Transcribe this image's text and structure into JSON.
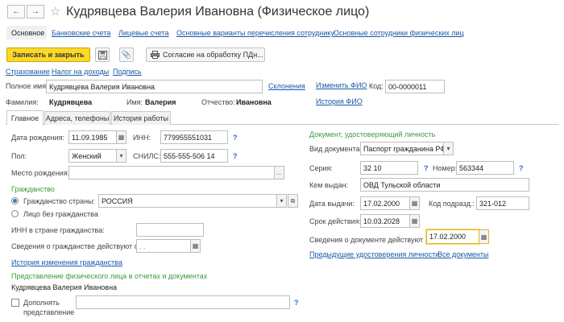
{
  "window": {
    "title": "Кудрявцева Валерия Ивановна (Физическое лицо)",
    "back_icon": "arrow-left-icon",
    "forward_icon": "arrow-right-icon",
    "star_icon": "star-icon"
  },
  "top_tabs": [
    "Основное",
    "Банковские счета",
    "Лицевые счета",
    "Основные варианты перечисления сотруднику",
    "Основные сотрудники физических лиц"
  ],
  "toolbar": {
    "save_close": "Записать и закрыть",
    "consent": "Согласие на обработку ПДн..."
  },
  "links_row": [
    "Страхование",
    "Налог на доходы",
    "Подпись"
  ],
  "person": {
    "full_name_label": "Полное имя:",
    "full_name": "Кудрявцева Валерия Ивановна",
    "declension": "Склонения",
    "change_fio": "Изменить ФИО",
    "code_label": "Код:",
    "code": "00-0000011",
    "history_fio": "История ФИО",
    "surname_label": "Фамилия:",
    "surname": "Кудрявцева",
    "name_label": "Имя:",
    "name": "Валерия",
    "patronymic_label": "Отчество:",
    "patronymic": "Ивановна"
  },
  "inner_tabs": [
    "Главное",
    "Адреса, телефоны",
    "История работы"
  ],
  "main": {
    "birth_label": "Дата рождения:",
    "birth": "11.09.1985",
    "inn_label": "ИНН:",
    "inn": "779955551031",
    "gender_label": "Пол:",
    "gender": "Женский",
    "snils_label": "СНИЛС:",
    "snils": "555-555-506 14",
    "birthplace_label": "Место рождения:",
    "birthplace": "",
    "citizenship_header": "Гражданство",
    "citizen_label": "Гражданство страны:",
    "country": "РОССИЯ",
    "stateless_label": "Лицо без гражданства",
    "foreign_inn_label": "ИНН в стране гражданства:",
    "citizen_valid_label": "Сведения о гражданстве действуют с:",
    "citizen_valid": " .  .",
    "citizen_history": "История изменения гражданства",
    "representation_header": "Представление физического лица в отчетах и документах",
    "representation": "Кудрявцева Валерия Ивановна",
    "supplement_label_1": "Дополнять",
    "supplement_label_2": "представление",
    "q": "?"
  },
  "doc": {
    "header": "Документ, удостоверяющий личность",
    "type_label": "Вид документа:",
    "type": "Паспорт гражданина РФ",
    "series_label": "Серия:",
    "series": "32 10",
    "number_label": "Номер:",
    "number": "563344",
    "issued_by_label": "Кем выдан:",
    "issued_by": "ОВД Тульской области",
    "issue_date_label": "Дата выдачи:",
    "issue_date": "17.02.2000",
    "dept_code_label": "Код подразд.:",
    "dept_code": "321-012",
    "expiry_label": "Срок действия:",
    "expiry": "10.03.2028",
    "valid_from_label": "Сведения о документе действуют с:",
    "valid_from": "17.02.2000",
    "prev_docs": "Предыдущие удостоверения личности",
    "all_docs": "Все документы"
  }
}
